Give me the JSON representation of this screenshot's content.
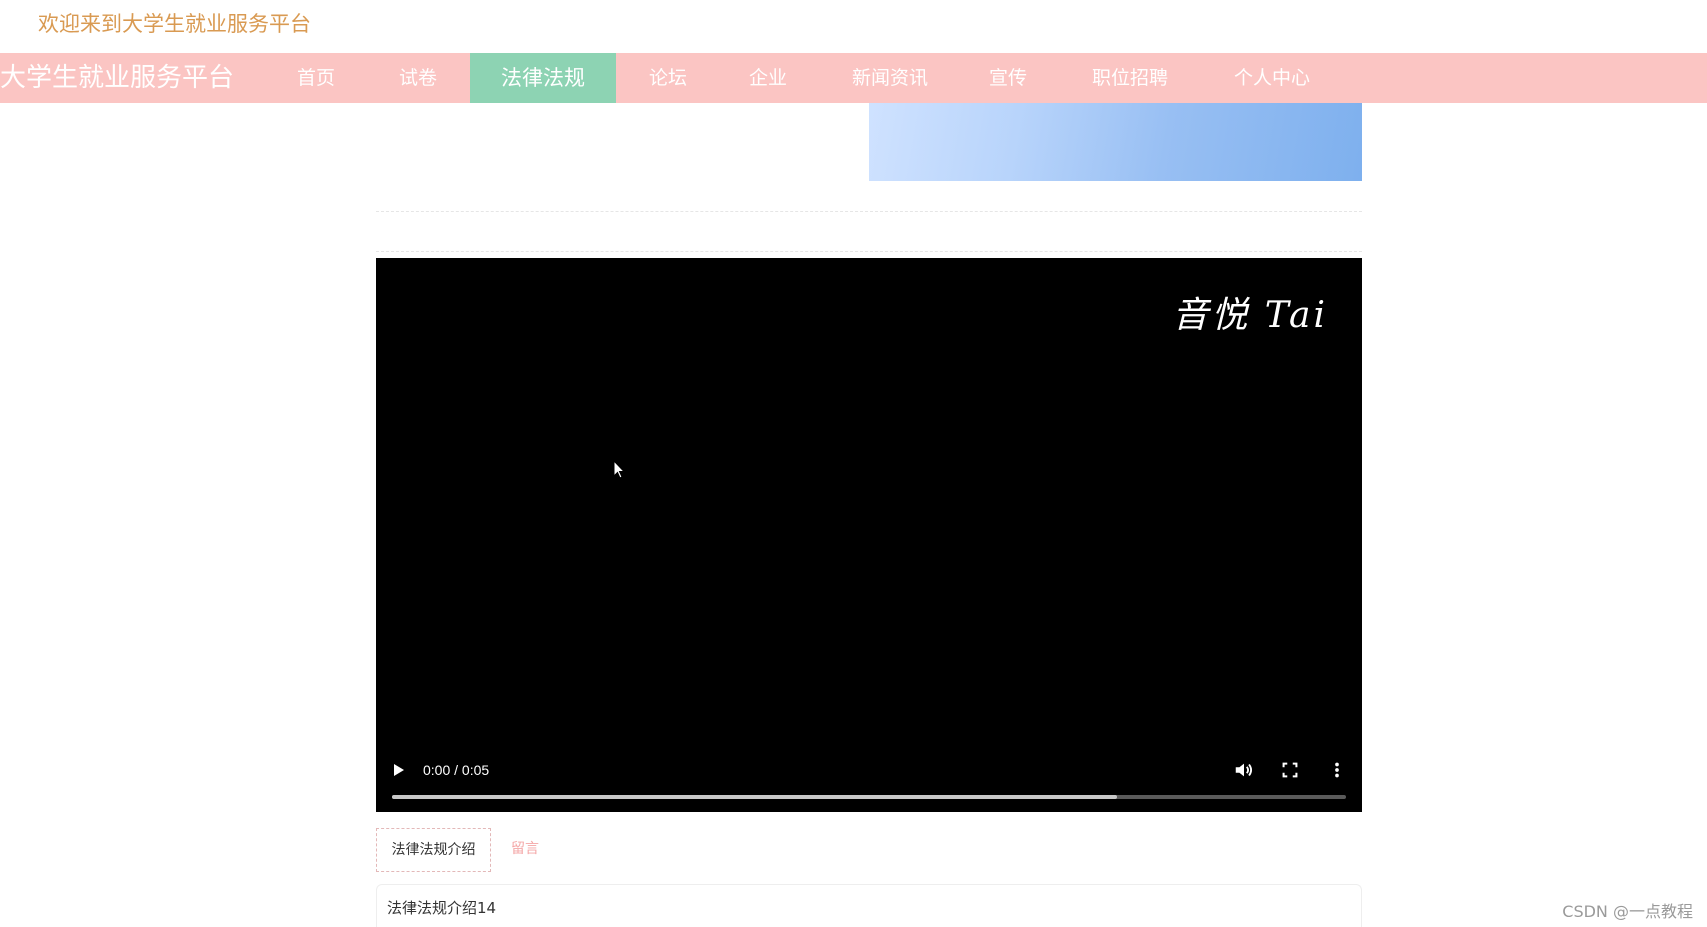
{
  "header": {
    "welcome_text": "欢迎来到大学生就业服务平台"
  },
  "navbar": {
    "brand": "大学生就业服务平台",
    "items": [
      {
        "label": "首页"
      },
      {
        "label": "试卷"
      },
      {
        "label": "法律法规",
        "active": true
      },
      {
        "label": "论坛"
      },
      {
        "label": "企业"
      },
      {
        "label": "新闻资讯"
      },
      {
        "label": "宣传"
      },
      {
        "label": "职位招聘"
      },
      {
        "label": "个人中心"
      }
    ],
    "colors": {
      "bar": "#fbc5c3",
      "active": "#8dd3b3"
    }
  },
  "video": {
    "overlay_text": "音悦 Tai",
    "time_display": "0:00 / 0:05",
    "buffered_fraction": 0.76,
    "icons": [
      "play-icon",
      "volume-icon",
      "fullscreen-icon",
      "more-options-icon"
    ]
  },
  "tabs": [
    {
      "label": "法律法规介绍",
      "active": true
    },
    {
      "label": "留言",
      "active": false
    }
  ],
  "content": {
    "text": "法律法规介绍14"
  },
  "watermark": "CSDN @一点教程"
}
